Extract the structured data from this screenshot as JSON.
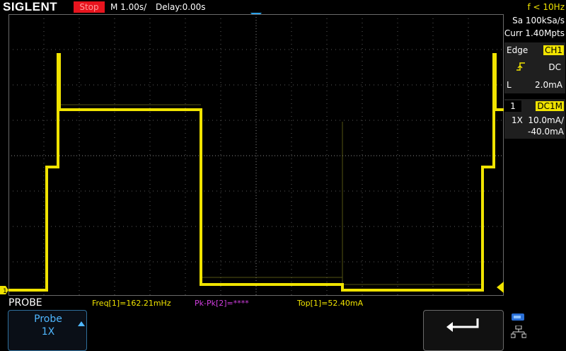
{
  "header": {
    "brand": "SIGLENT",
    "run_state": "Stop",
    "timebase": "M 1.00s/",
    "delay": "Delay:0.00s",
    "trigger_freq": "f < 10Hz"
  },
  "acq": {
    "sample_rate": "Sa 100kSa/s",
    "memory": "Curr 1.40Mpts"
  },
  "trigger": {
    "type_label": "Edge",
    "source": "CH1",
    "coupling": "DC",
    "level_label": "L",
    "level": "2.0mA"
  },
  "channel": {
    "number": "1",
    "coupling": "DC1M",
    "probe": "1X",
    "scale": "10.0mA/",
    "offset": "-40.0mA"
  },
  "measurements": {
    "freq": "Freq[1]=162.21mHz",
    "pkpk": "Pk-Pk[2]=****",
    "top": "Top[1]=52.40mA"
  },
  "menu": {
    "title": "PROBE",
    "probe_label": "Probe",
    "probe_value": "1X"
  },
  "colors": {
    "ch1": "#f0e300",
    "measure_pkpk": "#d23ee0",
    "accent_blue": "#4fb7ff"
  }
}
